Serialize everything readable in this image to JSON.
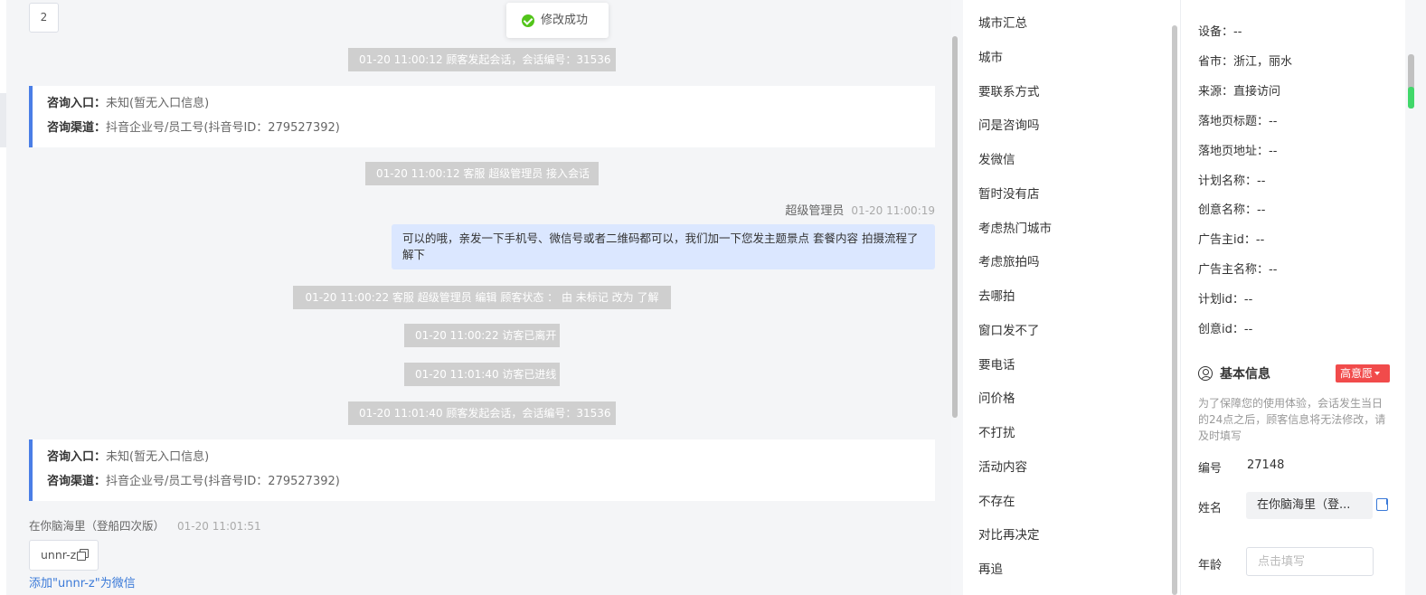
{
  "toast": {
    "text": "修改成功"
  },
  "chat": {
    "page_number": "2",
    "system_messages": [
      "01-20 11:00:12 顾客发起会话，会话编号：31536",
      "01-20 11:00:12 客服 超级管理员 接入会话",
      "01-20 11:00:22 客服 超级管理员 编辑 顾客状态 ： 由 未标记 改为 了解",
      "01-20 11:00:22 访客已离开",
      "01-20 11:01:40 访客已进线",
      "01-20 11:01:40 顾客发起会话，会话编号：31536"
    ],
    "consult_cards": [
      {
        "entry_label": "咨询入口：",
        "entry_value": "未知(暂无入口信息)",
        "channel_label": "咨询渠道：",
        "channel_value": "抖音企业号/员工号(抖音号ID：279527392)"
      },
      {
        "entry_label": "咨询入口：",
        "entry_value": "未知(暂无入口信息)",
        "channel_label": "咨询渠道：",
        "channel_value": "抖音企业号/员工号(抖音号ID：279527392)"
      }
    ],
    "agent_message": {
      "sender": "超级管理员",
      "time": "01-20 11:00:19",
      "text": "可以的哦，亲发一下手机号、微信号或者二维码都可以，我们加一下您发主题景点 套餐内容 拍摄流程了解下"
    },
    "visitor_message": {
      "sender": "在你脑海里（登船四次版）",
      "time": "01-20 11:01:51",
      "text": "unnr-z"
    },
    "add_wechat_link": "添加\"unnr-z\"为微信"
  },
  "tags": [
    "城市汇总",
    "城市",
    "要联系方式",
    "问是咨询吗",
    "发微信",
    "暂时没有店",
    "考虑热门城市",
    "考虑旅拍吗",
    "去哪拍",
    "窗口发不了",
    "要电话",
    "问价格",
    "不打扰",
    "活动内容",
    "不存在",
    "对比再决定",
    "再追"
  ],
  "info": {
    "rows": [
      {
        "label": "设备：",
        "value": "--"
      },
      {
        "label": "省市：",
        "value": "浙江，丽水"
      },
      {
        "label": "来源：",
        "value": "直接访问"
      },
      {
        "label": "落地页标题：",
        "value": "--"
      },
      {
        "label": "落地页地址：",
        "value": "--"
      },
      {
        "label": "计划名称：",
        "value": "--"
      },
      {
        "label": "创意名称：",
        "value": "--"
      },
      {
        "label": "广告主id：",
        "value": "--"
      },
      {
        "label": "广告主名称：",
        "value": "--"
      },
      {
        "label": "计划id：",
        "value": "--"
      },
      {
        "label": "创意id：",
        "value": "--"
      }
    ],
    "basic_title": "基本信息",
    "intent_badge": "高意愿",
    "notice": "为了保障您的使用体验，会话发生当日的24点之后，顾客信息将无法修改，请及时填写",
    "id_label": "编号",
    "id_value": "27148",
    "name_label": "姓名",
    "name_value": "在你脑海里（登...",
    "age_label": "年龄",
    "age_placeholder": "点击填写"
  },
  "colors": {
    "accent_blue": "#4a7ee6",
    "link": "#3b7ad8",
    "badge_red": "#f14b4b",
    "success": "#52c41a"
  },
  "icons": [
    "check-circle-icon",
    "copy-icon",
    "user-circle-icon",
    "chevron-down-icon",
    "edit-icon"
  ]
}
